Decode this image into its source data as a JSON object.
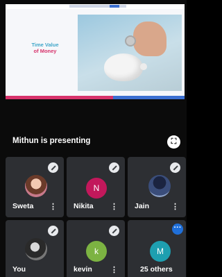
{
  "presentation": {
    "slide_title_line1": "Time Value",
    "slide_title_line2": "of Money"
  },
  "presenting": {
    "text": "Mithun is presenting",
    "fullscreen_icon": "fullscreen-icon"
  },
  "participants": [
    {
      "name": "Sweta",
      "avatar": "photo",
      "muted": true,
      "more": "⋮"
    },
    {
      "name": "Nikita",
      "avatar_letter": "N",
      "avatar_color": "#c2185b",
      "muted": true,
      "more": "⋮"
    },
    {
      "name": "Jain",
      "avatar": "photo",
      "muted": true,
      "more": "⋮"
    },
    {
      "name": "You",
      "avatar": "photo",
      "muted": true
    },
    {
      "name": "kevin",
      "avatar_letter": "k",
      "avatar_color": "#7cb342",
      "muted": true,
      "more": "⋮"
    },
    {
      "name": "25 others",
      "avatar_letter": "M",
      "avatar_color": "#1e9fb0"
    }
  ],
  "colors": {
    "tile_bg": "#2d2f33",
    "accent_blue": "#1f6fd9",
    "slide_title_blue": "#3fa6c9",
    "slide_title_pink": "#d7336b"
  }
}
